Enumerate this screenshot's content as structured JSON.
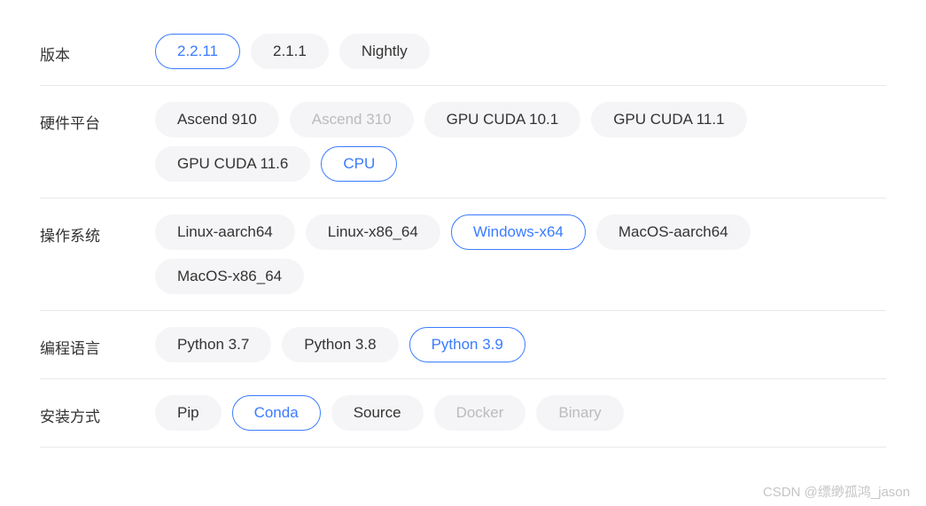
{
  "rows": [
    {
      "label": "版本",
      "options": [
        {
          "text": "2.2.11",
          "selected": true,
          "disabled": false
        },
        {
          "text": "2.1.1",
          "selected": false,
          "disabled": false
        },
        {
          "text": "Nightly",
          "selected": false,
          "disabled": false
        }
      ]
    },
    {
      "label": "硬件平台",
      "options": [
        {
          "text": "Ascend 910",
          "selected": false,
          "disabled": false
        },
        {
          "text": "Ascend 310",
          "selected": false,
          "disabled": true
        },
        {
          "text": "GPU CUDA 10.1",
          "selected": false,
          "disabled": false
        },
        {
          "text": "GPU CUDA 11.1",
          "selected": false,
          "disabled": false
        },
        {
          "text": "GPU CUDA 11.6",
          "selected": false,
          "disabled": false
        },
        {
          "text": "CPU",
          "selected": true,
          "disabled": false
        }
      ]
    },
    {
      "label": "操作系统",
      "options": [
        {
          "text": "Linux-aarch64",
          "selected": false,
          "disabled": false
        },
        {
          "text": "Linux-x86_64",
          "selected": false,
          "disabled": false
        },
        {
          "text": "Windows-x64",
          "selected": true,
          "disabled": false
        },
        {
          "text": "MacOS-aarch64",
          "selected": false,
          "disabled": false
        },
        {
          "text": "MacOS-x86_64",
          "selected": false,
          "disabled": false
        }
      ]
    },
    {
      "label": "编程语言",
      "options": [
        {
          "text": "Python 3.7",
          "selected": false,
          "disabled": false
        },
        {
          "text": "Python 3.8",
          "selected": false,
          "disabled": false
        },
        {
          "text": "Python 3.9",
          "selected": true,
          "disabled": false
        }
      ]
    },
    {
      "label": "安装方式",
      "options": [
        {
          "text": "Pip",
          "selected": false,
          "disabled": false
        },
        {
          "text": "Conda",
          "selected": true,
          "disabled": false
        },
        {
          "text": "Source",
          "selected": false,
          "disabled": false
        },
        {
          "text": "Docker",
          "selected": false,
          "disabled": true
        },
        {
          "text": "Binary",
          "selected": false,
          "disabled": true
        }
      ]
    }
  ],
  "watermark": "CSDN @缥缈孤鸿_jason"
}
